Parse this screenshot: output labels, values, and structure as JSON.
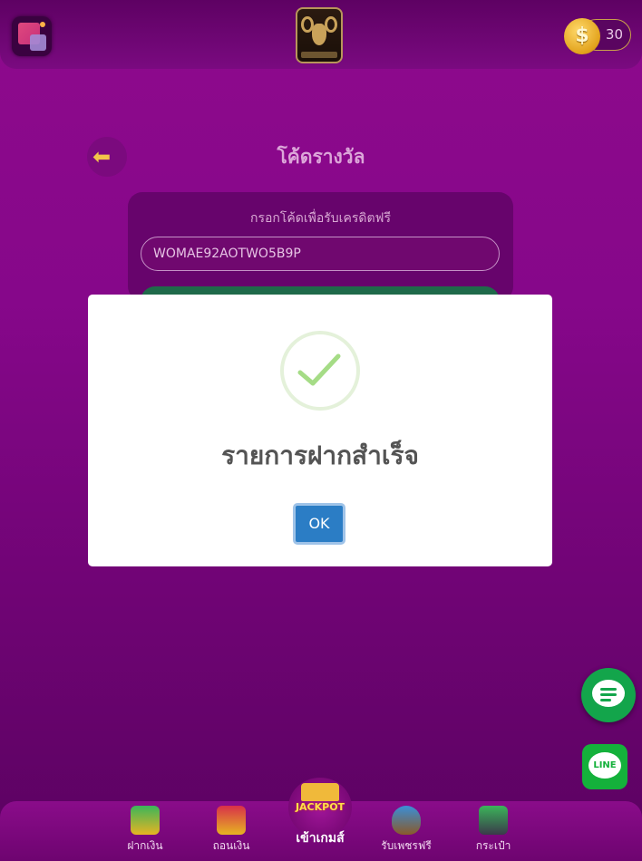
{
  "header": {
    "menu_icon": "app-grid-icon",
    "logo_icon": "goat-logo-icon",
    "coin_symbol": "$",
    "credit_balance": "30"
  },
  "page": {
    "title": "โค้ดรางวัล",
    "back_icon": "back-arrow-icon",
    "code_label": "กรอกโค้ดเพื่อรับเครดิตฟรี",
    "code_value": "WOMAE92AOTWO5B9P"
  },
  "dialog": {
    "icon": "success-check-icon",
    "title": "รายการฝากสำเร็จ",
    "ok_label": "OK"
  },
  "floating": {
    "chat_icon": "chat-bubble-icon",
    "line_text": "LINE"
  },
  "bottom_nav": {
    "items": [
      {
        "label": "ฝากเงิน",
        "icon": "deposit-icon"
      },
      {
        "label": "ถอนเงิน",
        "icon": "withdraw-icon"
      },
      {
        "label": "รับเพชรฟรี",
        "icon": "free-diamond-icon"
      },
      {
        "label": "กระเป๋า",
        "icon": "wallet-icon"
      }
    ],
    "jackpot_badge": "JACKPOT",
    "jackpot_label": "เข้าเกมส์"
  },
  "colors": {
    "background": "#86078a",
    "dialog_ok": "#2b7dc5",
    "success_check": "#a5dc86",
    "line_green": "#14b13b"
  }
}
